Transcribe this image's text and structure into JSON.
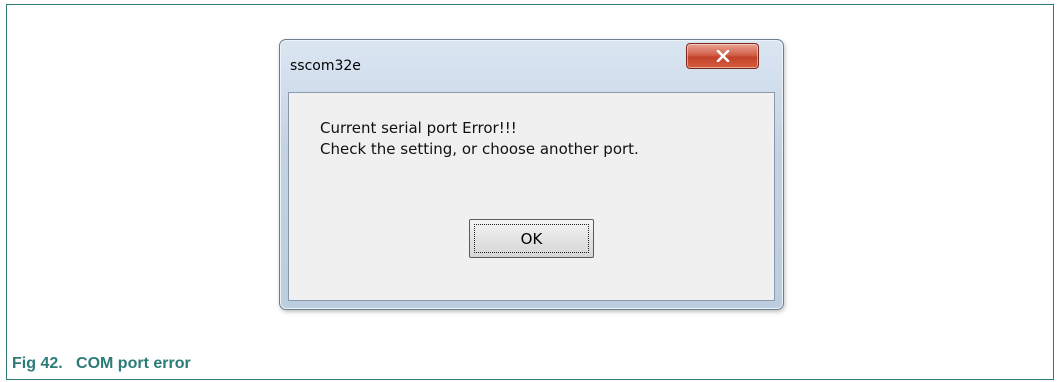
{
  "dialog": {
    "title": "sscom32e",
    "close_icon": "close-icon",
    "message_lines": [
      "Current serial port Error!!!",
      "Check the setting, or choose another port."
    ],
    "ok_label": "OK"
  },
  "caption": {
    "text": "Fig 42.   COM port error"
  }
}
